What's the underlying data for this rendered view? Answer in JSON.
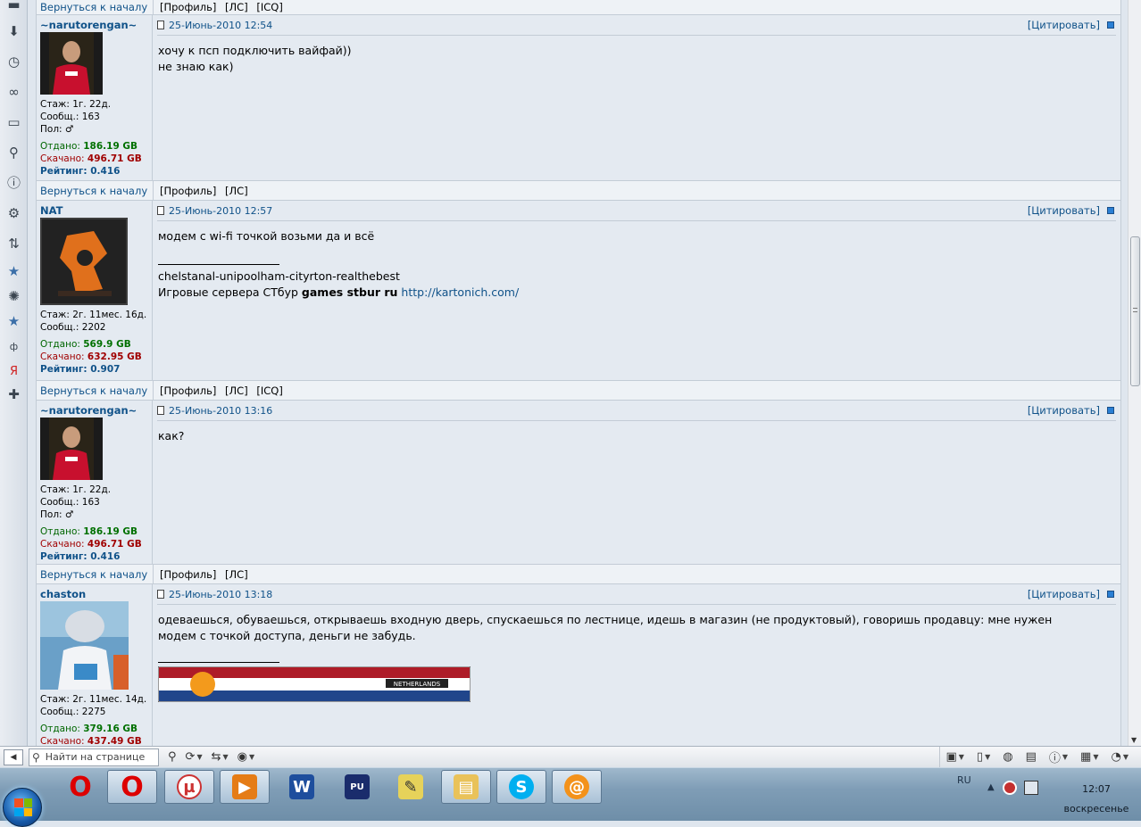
{
  "sidebar": {
    "icons": [
      "bookmark-icon",
      "download-icon",
      "history-icon",
      "links-icon",
      "notes-icon",
      "search-icon",
      "info-icon",
      "settings-icon",
      "transfers-icon",
      "favorite-icon",
      "gear-icon",
      "favorite-icon-2",
      "translate-icon",
      "yandex-icon",
      "add-panel-icon"
    ]
  },
  "forum": {
    "back_label": "Вернуться к началу",
    "quote_label": "[Цитировать]",
    "bars": [
      {
        "links": [
          "[Профиль]",
          "[ЛС]",
          "[ICQ]"
        ]
      },
      {
        "links": [
          "[Профиль]",
          "[ЛС]"
        ]
      },
      {
        "links": [
          "[Профиль]",
          "[ЛС]",
          "[ICQ]"
        ]
      },
      {
        "links": [
          "[Профиль]",
          "[ЛС]"
        ]
      }
    ],
    "posts": [
      {
        "nick": "~narutorengan~",
        "stats": [
          "Стаж: 1г. 22д.",
          "Сообщ.: 163",
          "Пол: ♂"
        ],
        "up_label": "Отдано:",
        "up": "186.19 GB",
        "down_label": "Скачано:",
        "down": "496.71 GB",
        "rating_label": "Рейтинг:",
        "rating": "0.416",
        "date": "25-Июнь-2010 12:54",
        "lines": [
          "хочу к псп подключить вайфай))",
          "не знаю как)"
        ]
      },
      {
        "nick": "NAT",
        "stats": [
          "Стаж: 2г. 11мес. 16д.",
          "Сообщ.: 2202"
        ],
        "up_label": "Отдано:",
        "up": "569.9 GB",
        "down_label": "Скачано:",
        "down": "632.95 GB",
        "rating_label": "Рейтинг:",
        "rating": "0.907",
        "date": "25-Июнь-2010 12:57",
        "lines": [
          "модем с wi-fi точкой возьми да и всё"
        ],
        "sig1": "chelstanal-unipoolham-cityrton-realthebest",
        "sig2_pre": "Игровые сервера СТбур ",
        "sig2_bold": "games stbur ru",
        "sig2_link": "http://kartonich.com/"
      },
      {
        "nick": "~narutorengan~",
        "stats": [
          "Стаж: 1г. 22д.",
          "Сообщ.: 163",
          "Пол: ♂"
        ],
        "up_label": "Отдано:",
        "up": "186.19 GB",
        "down_label": "Скачано:",
        "down": "496.71 GB",
        "rating_label": "Рейтинг:",
        "rating": "0.416",
        "date": "25-Июнь-2010 13:16",
        "lines": [
          "как?"
        ]
      },
      {
        "nick": "chaston",
        "stats": [
          "Стаж: 2г. 11мес. 14д.",
          "Сообщ.: 2275"
        ],
        "up_label": "Отдано:",
        "up": "379.16 GB",
        "down_label": "Скачано:",
        "down": "437.49 GB",
        "date": "25-Июнь-2010 13:18",
        "lines": [
          "одеваешься, обуваешься, открываешь входную дверь, спускаешься по лестнице, идешь в магазин (не продуктовый), говоришь продавцу: мне нужен модем с точкой доступа, деньги не забудь."
        ],
        "banner_text": "NETHERLANDS"
      }
    ]
  },
  "findbar": {
    "placeholder": "Найти на странице"
  },
  "taskbar": {
    "lang": "RU",
    "time": "12:07",
    "day": "воскресенье",
    "apps": [
      "opera-icon",
      "opera-icon-2",
      "utorrent-icon",
      "media-player-icon",
      "word-icon",
      "save-icon",
      "tag-icon",
      "explorer-icon",
      "skype-icon",
      "mail-agent-icon"
    ]
  },
  "colors": {
    "link": "#105289",
    "up": "#007000",
    "down": "#a00000",
    "post_bg": "#e4eaf1"
  }
}
